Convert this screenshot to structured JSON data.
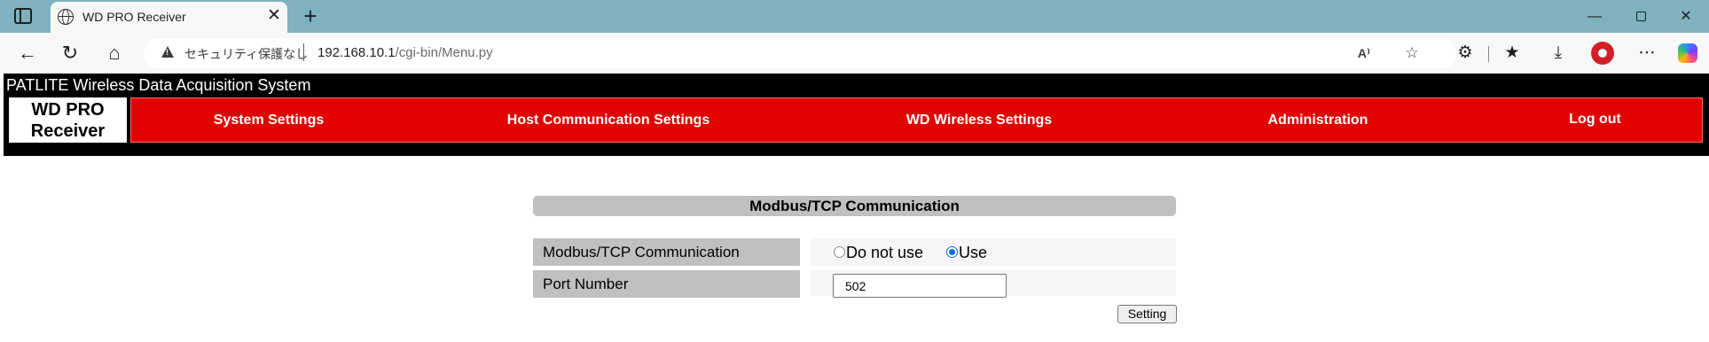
{
  "browser": {
    "tab_title": "WD PRO Receiver",
    "tab_close_glyph": "✕",
    "new_tab_glyph": "+",
    "window_minimize": "—",
    "window_close": "✕",
    "security_label": "セキュリティ保護なし",
    "url_host": "192.168.10.1",
    "url_path": "/cgi-bin/Menu.py",
    "read_aloud_glyph": "A⁾",
    "icons": [
      "sidebar-icon",
      "globe-icon",
      "back-arrow-icon",
      "reload-icon",
      "home-icon",
      "warning-icon",
      "read-aloud-icon",
      "favorite-star-icon",
      "extensions-icon",
      "favorites-icon",
      "download-icon",
      "profile-icon",
      "more-icon",
      "copilot-icon"
    ]
  },
  "page": {
    "system_title": "PATLITE Wireless Data Acquisition System",
    "logo_line1": "WD PRO",
    "logo_line2": "Receiver",
    "nav": {
      "system_settings": "System Settings",
      "host_comm": "Host Communication Settings",
      "wd_wireless": "WD Wireless Settings",
      "administration": "Administration",
      "logout": "Log out"
    },
    "section_title": "Modbus/TCP Communication",
    "rows": {
      "modbus_label": "Modbus/TCP Communication",
      "option_not_use": "Do not use",
      "option_use": "Use",
      "selected_option": "Use",
      "port_label": "Port Number",
      "port_value": "502"
    },
    "setting_button": "Setting"
  },
  "colors": {
    "tabbar_bg": "#7fb1bf",
    "header_bg": "#000000",
    "nav_bg": "#e30000",
    "label_bg": "#c0c0c0",
    "radio_checked": "#0f6fd8"
  }
}
